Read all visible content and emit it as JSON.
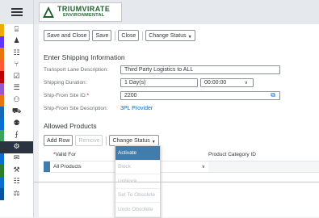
{
  "brand": {
    "line1": "TRIUMVIRATE",
    "line2": "ENVIRONMENTAL",
    "color": "#1f5f2e"
  },
  "rail": {
    "items": [
      {
        "icon": "briefcase-icon",
        "glyph": "⌸",
        "color": "#f0ab00"
      },
      {
        "icon": "person-flask-icon",
        "glyph": "♟",
        "color": "#5d36ff"
      },
      {
        "icon": "clipboard-icon",
        "glyph": "☷",
        "color": "#e9730c"
      },
      {
        "icon": "share-icon",
        "glyph": "⑂",
        "color": "#ff5a37"
      },
      {
        "icon": "clipboard-check-icon",
        "glyph": "☑",
        "color": "#bb0000"
      },
      {
        "icon": "clipboard-list-icon",
        "glyph": "☰",
        "color": "#925ace"
      },
      {
        "icon": "people-icon",
        "glyph": "⚇",
        "color": "#e9730c"
      },
      {
        "icon": "car-icon",
        "glyph": "⛟",
        "color": "#1866b4"
      },
      {
        "icon": "group-icon",
        "glyph": "⚉",
        "color": "#0a6ed1"
      },
      {
        "icon": "chart-icon",
        "glyph": "⨍",
        "color": "#3fa45b"
      },
      {
        "icon": "settings-icon",
        "glyph": "⚙",
        "color": "#2a3440",
        "active": true
      },
      {
        "icon": "megaphone-icon",
        "glyph": "✉",
        "color": "#0a6ed1"
      },
      {
        "icon": "tools-icon",
        "glyph": "⚒",
        "color": "#2b7c2b"
      },
      {
        "icon": "grid-icon",
        "glyph": "☷",
        "color": "#0a6ed1"
      },
      {
        "icon": "money-icon",
        "glyph": "⚖",
        "color": "#0854a0"
      }
    ]
  },
  "toolbar": {
    "save_close": "Save and Close",
    "save": "Save",
    "close": "Close",
    "change_status": "Change Status"
  },
  "shipping": {
    "title": "Enter Shipping Information",
    "transport_lane_label": "Transport Lane Description:",
    "transport_lane_value": "Third Party Logistics to ALL",
    "duration_label": "Shipping Duration:",
    "duration_days": "1 Day(s)",
    "duration_time": "00:00:00",
    "site_id_label": "Ship-From Site ID:",
    "site_id_required": "*",
    "site_id_value": "2200",
    "site_desc_label": "Ship-From Site Description:",
    "site_desc_value": "3PL Provider"
  },
  "products": {
    "title": "Allowed Products",
    "add_row": "Add Row",
    "remove": "Remove",
    "change_status": "Change Status",
    "col_valid_for_req": "*",
    "col_valid_for": "Valid For",
    "col_category": "Product Category ID",
    "row_value": "All Products"
  },
  "status_menu": {
    "items": [
      {
        "label": "Activate",
        "enabled": true
      },
      {
        "label": "Block",
        "enabled": false
      },
      {
        "label": "Unblock",
        "enabled": false
      },
      {
        "label": "Set To Obsolete",
        "enabled": false
      },
      {
        "label": "Undo Obsolete",
        "enabled": false
      }
    ]
  }
}
